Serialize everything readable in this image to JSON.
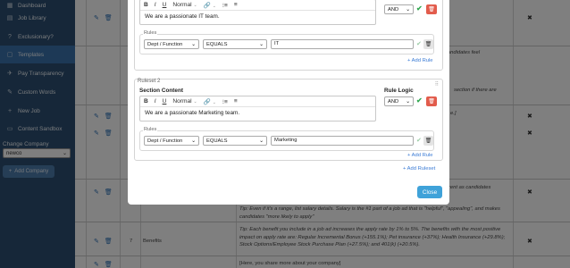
{
  "sidebar": {
    "items": [
      {
        "label": "Dashboard",
        "icon": "dashboard-icon",
        "glyph": "▦"
      },
      {
        "label": "Job Library",
        "icon": "book-icon",
        "glyph": "▤"
      },
      {
        "label": "Exclusionary?",
        "icon": "question-icon",
        "glyph": "?"
      },
      {
        "label": "Templates",
        "icon": "template-icon",
        "glyph": "▢"
      },
      {
        "label": "Pay Transparency",
        "icon": "money-icon",
        "glyph": "✈"
      },
      {
        "label": "Custom Words",
        "icon": "palette-icon",
        "glyph": "✎"
      },
      {
        "label": "New Job",
        "icon": "plus-icon",
        "glyph": "+"
      },
      {
        "label": "Content Sandbox",
        "icon": "sandbox-icon",
        "glyph": "▭"
      }
    ],
    "company_label": "Change Company",
    "company_value": "newco",
    "add_company": "Add Company"
  },
  "table": {
    "rows": [
      {
        "snippet": "candidates feel"
      },
      {
        "snippet": "section if there are"
      },
      {
        "snippet": "e.]"
      },
      {
        "snippet": ""
      },
      {
        "snippet": "rent as candidates"
      },
      {
        "number": "7",
        "name": "Benefits"
      },
      {
        "snippet": ""
      }
    ],
    "tip_salary": "Tip: Even if it's a range, list salary details. Salary is the #1 part of a job ad that is \"helpful\", \"appealing\", and makes candidates \"more likely to apply\"",
    "tip_benefits": "Tip: Each benefit you include in a job ad increases the apply rate by 1% to 5%. The benefits with the most positive impact on apply rate are: Regular Incremental Bonus (+155.1%); Pet insurance (+37%); Health Insurance (+29.8%); Stock Options/Employee Stock Purchase Plan (+27.5%); and 401(k) (+20.5%).",
    "company_prompt": "[Here, you share more about your company]"
  },
  "modal": {
    "rulesets": [
      {
        "title": "",
        "content": "We are a passionate IT team.",
        "logic": "AND",
        "rule": {
          "field": "Dept / Function",
          "operator": "EQUALS",
          "value": "IT"
        },
        "add_rule": "+ Add Rule"
      },
      {
        "title": "Ruleset 2",
        "section_label": "Section Content",
        "logic_label": "Rule Logic",
        "content": "We are a passionate Marketing team.",
        "logic": "AND",
        "rule": {
          "field": "Dept / Function",
          "operator": "EQUALS",
          "value": "Marketing"
        },
        "add_rule": "+ Add Rule"
      }
    ],
    "rules_label": "Rules",
    "toolbar": {
      "bold": "B",
      "italic": "I",
      "underline": "U",
      "format": "Normal"
    },
    "add_ruleset": "+ Add Ruleset",
    "close": "Close"
  },
  "colors": {
    "sidebar": "#2d4f72",
    "active": "#3b73ad",
    "accent": "#3fa2d9",
    "danger": "#e25c4c",
    "success": "#33a852"
  }
}
